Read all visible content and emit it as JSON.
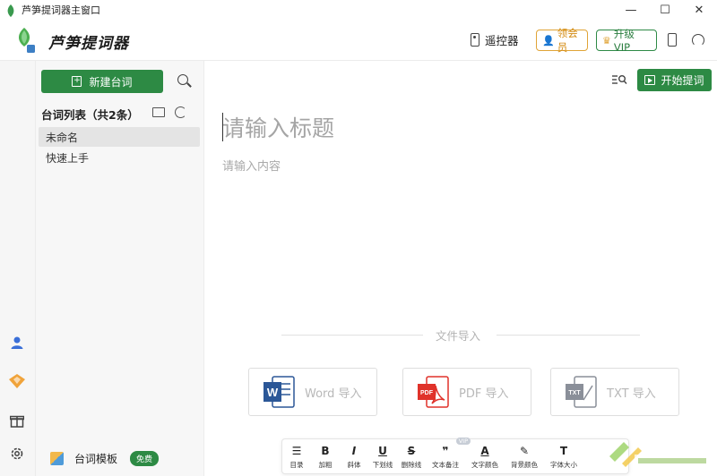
{
  "window": {
    "title": "芦笋提词器主窗口",
    "controls": [
      "—",
      "☐",
      "✕"
    ]
  },
  "header": {
    "brand": "芦笋提词器",
    "remote_label": "遥控器",
    "member_label": "领会员",
    "vip_label": "升级VIP"
  },
  "sidebar": {
    "new_button": "新建台词",
    "list_title": "台词列表（共2条）",
    "items": [
      {
        "label": "未命名",
        "active": true
      },
      {
        "label": "快速上手",
        "active": false
      }
    ],
    "template_label": "台词模板",
    "free_badge": "免费"
  },
  "editor": {
    "start_button": "开始提词",
    "title_placeholder": "请输入标题",
    "content_placeholder": "请输入内容",
    "import_label": "文件导入",
    "import_cards": [
      {
        "label": "Word 导入",
        "icon": "word-icon",
        "color": "#2b5797"
      },
      {
        "label": "PDF 导入",
        "icon": "pdf-icon",
        "color": "#e0322a"
      },
      {
        "label": "TXT 导入",
        "icon": "txt-icon",
        "color": "#8a8f99"
      }
    ]
  },
  "toolbar": {
    "items": [
      {
        "glyph": "☰",
        "label": "目录",
        "icon": "list-icon"
      },
      {
        "glyph": "B",
        "label": "加粗",
        "icon": "bold-icon"
      },
      {
        "glyph": "I",
        "label": "斜体",
        "icon": "italic-icon"
      },
      {
        "glyph": "U",
        "label": "下划线",
        "icon": "underline-icon"
      },
      {
        "glyph": "S",
        "label": "删除线",
        "icon": "strikethrough-icon"
      },
      {
        "glyph": "❞",
        "label": "文本备注",
        "icon": "quote-icon",
        "vip": "VIP"
      },
      {
        "glyph": "A",
        "label": "文字颜色",
        "icon": "text-color-icon"
      },
      {
        "glyph": "✎",
        "label": "背景颜色",
        "icon": "highlight-icon"
      },
      {
        "glyph": "T",
        "label": "字体大小",
        "icon": "font-size-icon"
      }
    ]
  },
  "colors": {
    "brand_green": "#2d8a44",
    "gold": "#d38a10"
  }
}
